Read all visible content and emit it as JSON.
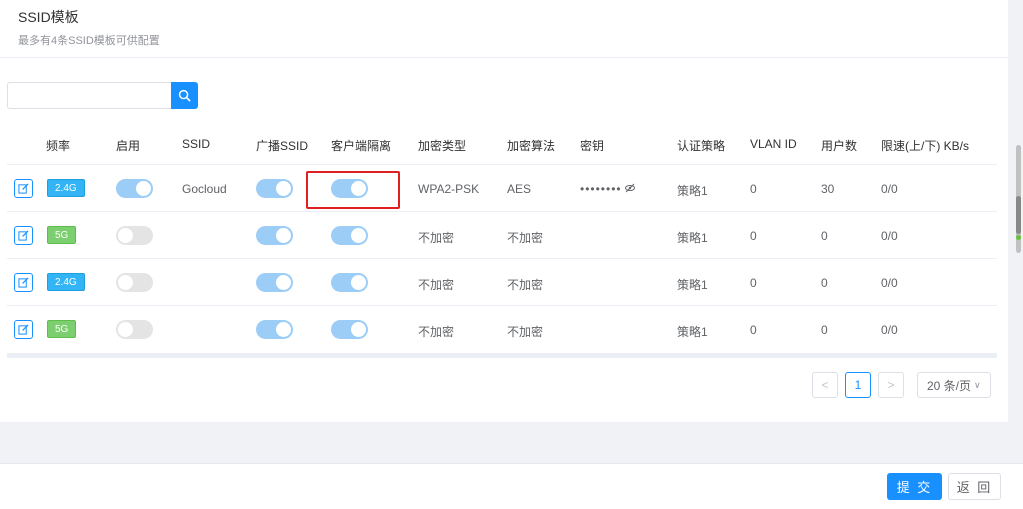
{
  "header": {
    "title": "SSID模板",
    "subtitle": "最多有4条SSID模板可供配置"
  },
  "search": {
    "value": "",
    "placeholder": "",
    "icon": "search-icon"
  },
  "table": {
    "columns": [
      "频率",
      "启用",
      "SSID",
      "广播SSID",
      "客户端隔离",
      "加密类型",
      "加密算法",
      "密钥",
      "认证策略",
      "VLAN ID",
      "用户数",
      "限速(上/下) KB/s"
    ],
    "rows": [
      {
        "band": "2.4G",
        "band_color": "#33b5f5",
        "enabled": true,
        "ssid": "Gocloud",
        "broadcast": true,
        "isolation": true,
        "enc_type": "WPA2-PSK",
        "enc_alg": "AES",
        "key": "••••••••",
        "key_icon": "eye-slash-icon",
        "auth": "策略1",
        "vlan": "0",
        "users": "30",
        "rate": "0/0"
      },
      {
        "band": "5G",
        "band_color": "#7ccf6e",
        "enabled": false,
        "ssid": "",
        "broadcast": true,
        "isolation": true,
        "enc_type": "不加密",
        "enc_alg": "不加密",
        "key": "",
        "auth": "策略1",
        "vlan": "0",
        "users": "0",
        "rate": "0/0"
      },
      {
        "band": "2.4G",
        "band_color": "#33b5f5",
        "enabled": false,
        "ssid": "",
        "broadcast": true,
        "isolation": true,
        "enc_type": "不加密",
        "enc_alg": "不加密",
        "key": "",
        "auth": "策略1",
        "vlan": "0",
        "users": "0",
        "rate": "0/0"
      },
      {
        "band": "5G",
        "band_color": "#7ccf6e",
        "enabled": false,
        "ssid": "",
        "broadcast": true,
        "isolation": true,
        "enc_type": "不加密",
        "enc_alg": "不加密",
        "key": "",
        "auth": "策略1",
        "vlan": "0",
        "users": "0",
        "rate": "0/0"
      }
    ]
  },
  "pagination": {
    "prev": "<",
    "current": "1",
    "next": ">",
    "page_size": "20 条/页"
  },
  "footer": {
    "submit_label": "提 交",
    "back_label": "返 回"
  },
  "colors": {
    "accent": "#1890ff",
    "highlight": "#e02020"
  }
}
